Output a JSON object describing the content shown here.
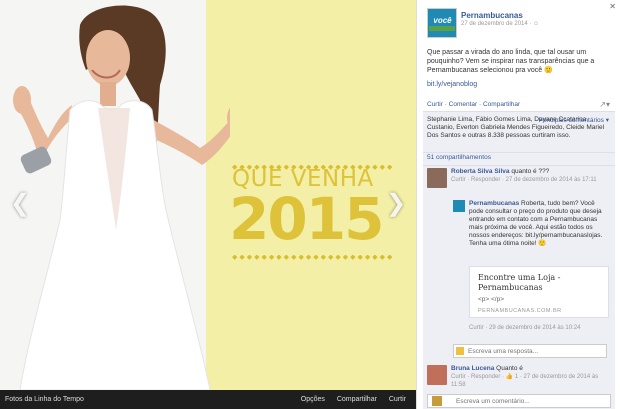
{
  "photo": {
    "headline": "QUE VENHA",
    "year": "2015",
    "dots": "◆◆◆◆◆◆◆◆◆◆◆◆◆◆◆◆◆◆◆◆◆◆◆◆◆◆",
    "album_link": "Fotos da Linha do Tempo",
    "actions": [
      "Opções",
      "Compartilhar",
      "Curtir"
    ],
    "arrow_left": "❮",
    "arrow_right": "❯"
  },
  "post": {
    "logo_text": "você",
    "page_name": "Pernambucanas",
    "date": "27 de dezembro de 2014 · ☺",
    "close": "✕",
    "text": "Que passar a virada do ano linda, que tal ousar um pouquinho? Vem se inspirar nas transparências que a Pernambucanas selecionou pra você 🙂",
    "link": "bit.ly/vejanoblog",
    "actions": "Curtir · Comentar · Compartilhar",
    "share_icon": "↗▾"
  },
  "ufi": {
    "likes_text": "Stephanie Lima, Fábio Gomes Lima, Dayane Ccatarina Custanio, Everton Gabriela Mendes Figueiredo, Cleide Mariel Dos Santos e outras 8.338 pessoas curtiram isso.",
    "relevant_label": "Principais comentários ▾",
    "shares": "51 compartilhamentos",
    "comment1": {
      "name": "Roberta Silva Silva",
      "text": "quanto é ???",
      "meta": "Curtir · Responder · 27 de dezembro de 2014 às 17:11"
    },
    "reply": {
      "name": "Pernambucanas",
      "text": "Roberta, tudo bem? Você pode consultar o preço do produto que deseja entrando em contato com a Pernambucanas mais próxima de você. Aqui estão todos os nossos endereços: bit.ly/pernambucanaslojas. Tenha uma ótima noite! 🙂",
      "preview_title": "Encontre uma Loja - Pernambucanas",
      "preview_sub": "<p> </p>",
      "preview_domain": "PERNAMBUCANAS.COM.BR",
      "meta": "Curtir · 29 de dezembro de 2014 às 10:24"
    },
    "reply_placeholder": "Escreva uma resposta...",
    "comment2": {
      "name": "Bruna Lucena",
      "text": "Quanto é",
      "meta": "Curtir · Responder · 👍 1 · 27 de dezembro de 2014 às 11:58"
    },
    "comment_placeholder": "Escreva um comentário..."
  },
  "colors": {
    "yellow": "#ddc23a",
    "facebook_blue": "#3b5998",
    "dark_bar": "#1e1e1e"
  }
}
